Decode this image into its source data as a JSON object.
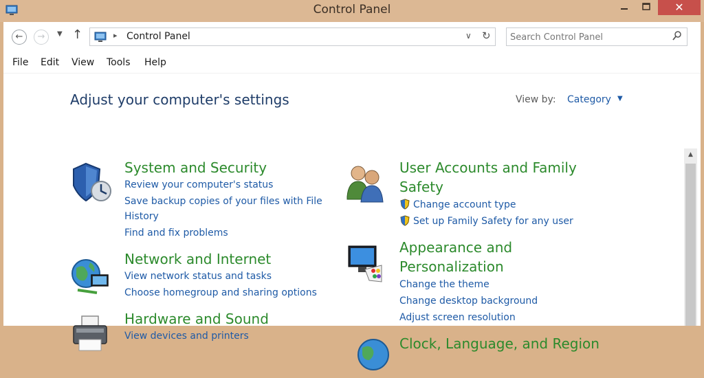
{
  "window": {
    "title": "Control Panel"
  },
  "address": {
    "crumb": "Control Panel"
  },
  "search": {
    "placeholder": "Search Control Panel"
  },
  "menu": [
    "File",
    "Edit",
    "View",
    "Tools",
    "Help"
  ],
  "main": {
    "title": "Adjust your computer's settings",
    "view_by_label": "View by:",
    "view_by_value": "Category"
  },
  "categories": [
    {
      "heading": "System and Security",
      "icon": "shield-icon",
      "links": [
        "Review your computer's status",
        "Save backup copies of your files with File",
        "History",
        "Find and fix problems"
      ]
    },
    {
      "heading": "Network and Internet",
      "icon": "globe-network-icon",
      "links": [
        "View network status and tasks",
        "Choose homegroup and sharing options"
      ]
    },
    {
      "heading": "Hardware and Sound",
      "icon": "printer-icon",
      "links": [
        "View devices and printers"
      ]
    },
    {
      "heading_line1": "User Accounts and Family",
      "heading_line2": "Safety",
      "icon": "users-icon",
      "links": [
        "Change account type",
        "Set up Family Safety for any user"
      ]
    },
    {
      "heading_line1": "Appearance and",
      "heading_line2": "Personalization",
      "icon": "display-palette-icon",
      "links": [
        "Change the theme",
        "Change desktop background",
        "Adjust screen resolution"
      ]
    },
    {
      "heading": "Clock, Language, and Region",
      "icon": "clock-globe-icon",
      "links": []
    }
  ],
  "colors": {
    "titlebar": "#dcb894",
    "heading": "#2c8a2c",
    "link": "#1e5aa6",
    "title": "#1e3c68",
    "close": "#c7504b"
  }
}
